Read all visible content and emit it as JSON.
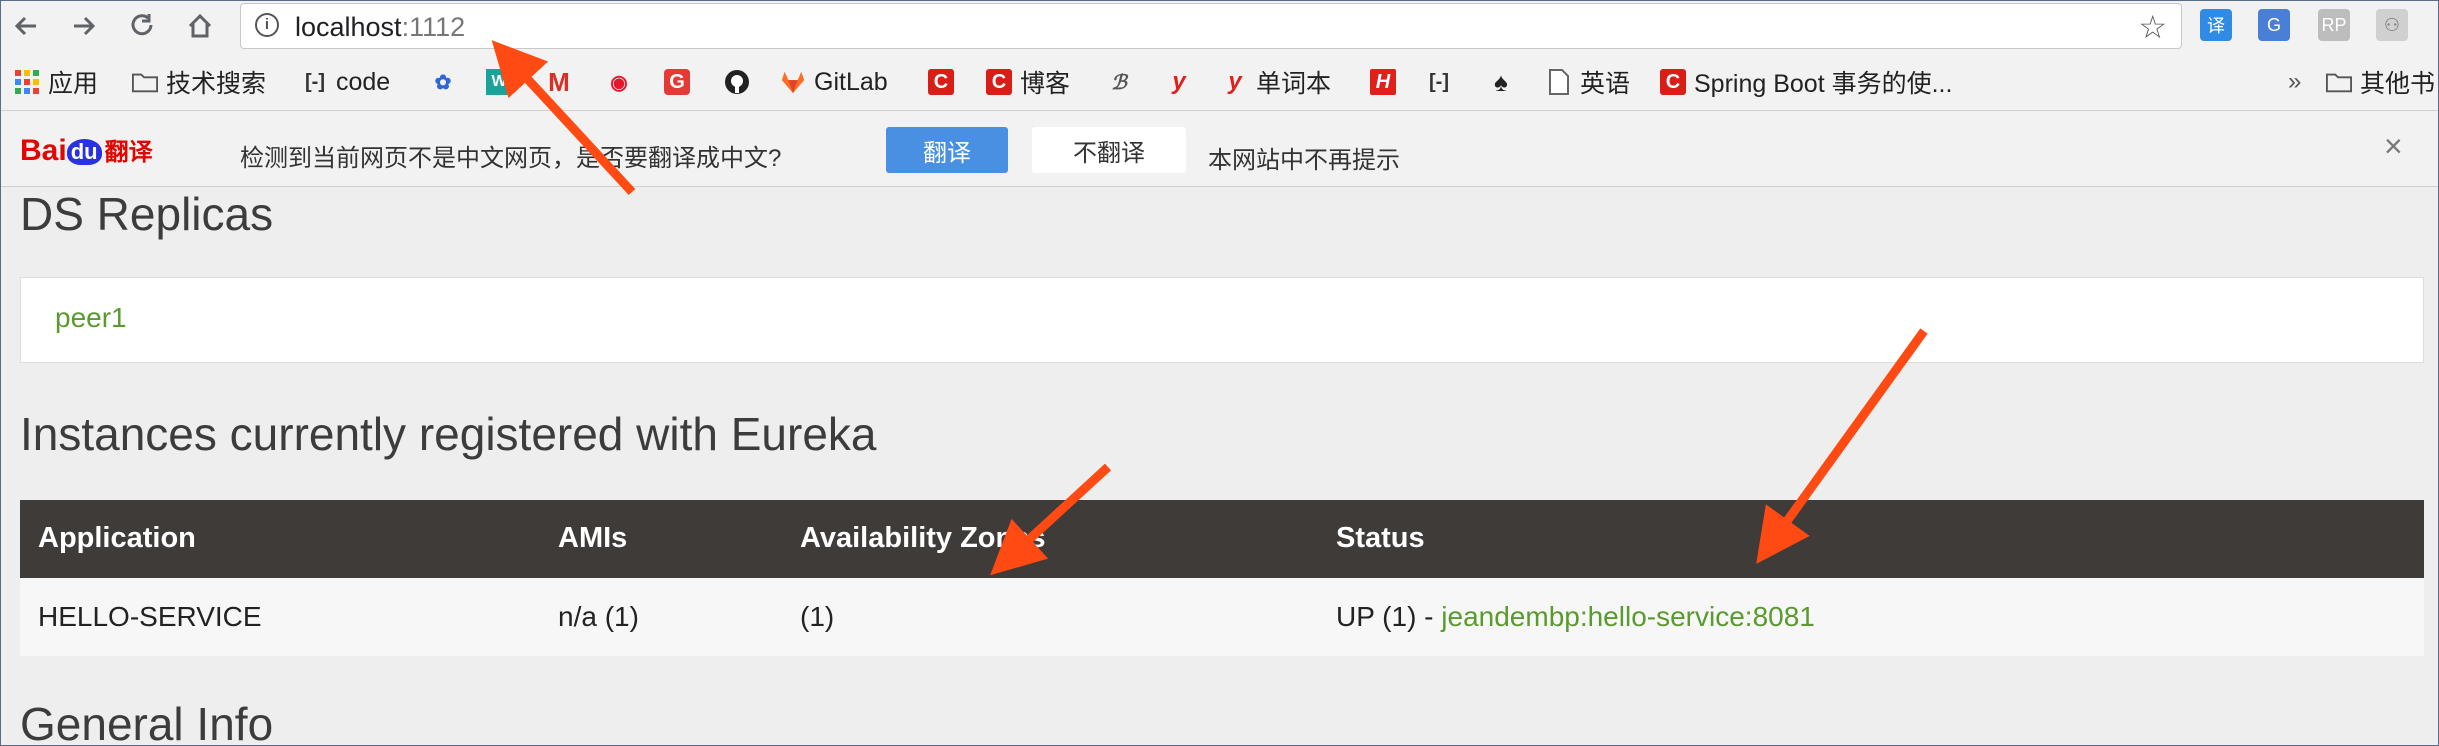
{
  "browser": {
    "url_host": "localhost",
    "url_port": ":1112",
    "bookmarks": [
      {
        "label": "应用",
        "icon": "apps-grid-icon"
      },
      {
        "label": "技术搜索",
        "icon": "folder-icon"
      },
      {
        "label": "code",
        "icon": "code-icon"
      },
      {
        "label": "",
        "icon": "baidu-paw-icon"
      },
      {
        "label": "",
        "icon": "m-mail-icon"
      },
      {
        "label": "",
        "icon": "weibo-icon"
      },
      {
        "label": "",
        "icon": "g-red-icon"
      },
      {
        "label": "",
        "icon": "github-icon"
      },
      {
        "label": "GitLab",
        "icon": "gitlab-icon"
      },
      {
        "label": "",
        "icon": "c-red-icon"
      },
      {
        "label": "博客",
        "icon": "c-red-icon"
      },
      {
        "label": "",
        "icon": "script-icon"
      },
      {
        "label": "",
        "icon": "y-red-icon"
      },
      {
        "label": "单词本",
        "icon": "y-red-icon"
      },
      {
        "label": "",
        "icon": "h-red-icon"
      },
      {
        "label": "",
        "icon": "code-icon"
      },
      {
        "label": "",
        "icon": "spade-icon"
      },
      {
        "label": "英语",
        "icon": "page-icon"
      },
      {
        "label": "Spring Boot 事务的使...",
        "icon": "c-red-icon"
      },
      {
        "label": "其他书",
        "icon": "folder-icon"
      }
    ],
    "more_label": "»"
  },
  "translate_bar": {
    "logo_bai": "Bai",
    "logo_du": "du",
    "logo_fanyi": "翻译",
    "message": "检测到当前网页不是中文网页，是否要翻译成中文?",
    "translate_label": "翻译",
    "no_translate_label": "不翻译",
    "never_label": "本网站中不再提示",
    "close_label": "×"
  },
  "page": {
    "ds_replicas_title": "DS Replicas",
    "replica": "peer1",
    "instances_title": "Instances currently registered with Eureka",
    "table": {
      "headers": [
        "Application",
        "AMIs",
        "Availability Zones",
        "Status"
      ],
      "rows": [
        {
          "application": "HELLO-SERVICE",
          "amis": "n/a (1)",
          "zones": "(1)",
          "status_prefix": "UP (1) - ",
          "status_link": "jeandembp:hello-service:8081"
        }
      ]
    },
    "general_info_title": "General Info"
  },
  "colors": {
    "link_green": "#5a9a2e",
    "table_header": "#3f3b38",
    "annotation_arrow": "#ff4a14"
  }
}
